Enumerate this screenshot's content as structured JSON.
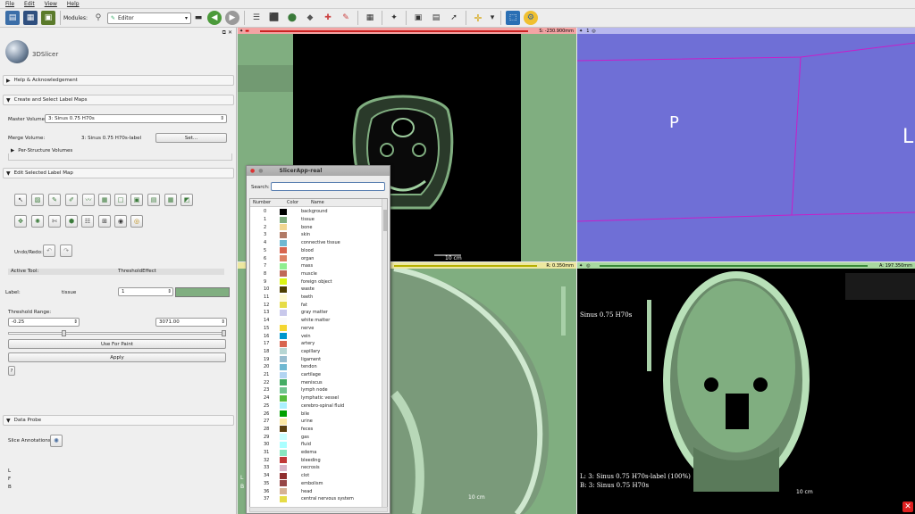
{
  "menu": [
    "File",
    "Edit",
    "View",
    "Help"
  ],
  "toolbar": {
    "modules_label": "Modules:",
    "module_value": "Editor"
  },
  "app_title": "3DSlicer",
  "sections": {
    "help": "Help & Acknowledgement",
    "create": "Create and Select Label Maps",
    "edit": "Edit Selected Label Map",
    "probe": "Data Probe"
  },
  "create": {
    "master_label": "Master Volume:",
    "master_value": "3: Sinus  0.75  H70s",
    "merge_label": "Merge Volume:",
    "merge_value": "3: Sinus  0.75  H70s-label",
    "set_button": "Set...",
    "per_structure": "Per-Structure Volumes"
  },
  "edit": {
    "undo_label": "Undo/Redo:",
    "active_tool_label": "Active Tool:",
    "active_tool_value": "ThresholdEffect",
    "label_label": "Label:",
    "label_name": "tissue",
    "label_value": "1",
    "threshold_label": "Threshold Range:",
    "thr_min": "-0.25",
    "thr_max": "3071.00",
    "use_for_paint": "Use For Paint",
    "apply": "Apply",
    "help_btn": "?"
  },
  "probe": {
    "slice_annotations": "Slice Annotations:",
    "coords": [
      "L",
      "F",
      "B"
    ]
  },
  "views": {
    "red_offset": "S: -230.900mm",
    "yellow_offset": "R: 0.350mm",
    "green_offset": "A: 197.350mm",
    "threeD_num": "1",
    "threeD_p": "P",
    "threeD_l": "L",
    "ruler": "10 cm",
    "green_volume": "Sinus  0.75  H70s",
    "green_label_line": "L: 3: Sinus  0.75  H70s-label (100%)",
    "green_bg_line": "B: 3: Sinus  0.75  H70s",
    "yellow_l": "L",
    "yellow_b": "B"
  },
  "popup": {
    "title": "SlicerApp-real",
    "search_label": "Search:",
    "headers": [
      "Number",
      "Color",
      "Name"
    ],
    "rows": [
      {
        "n": "0",
        "name": "background",
        "color": "#000000"
      },
      {
        "n": "1",
        "name": "tissue",
        "color": "#80ae80"
      },
      {
        "n": "2",
        "name": "bone",
        "color": "#f1d691"
      },
      {
        "n": "3",
        "name": "skin",
        "color": "#b17a65"
      },
      {
        "n": "4",
        "name": "connective tissue",
        "color": "#6fb8d2"
      },
      {
        "n": "5",
        "name": "blood",
        "color": "#d8654f"
      },
      {
        "n": "6",
        "name": "organ",
        "color": "#dd8265"
      },
      {
        "n": "7",
        "name": "mass",
        "color": "#90ee90"
      },
      {
        "n": "8",
        "name": "muscle",
        "color": "#c06858"
      },
      {
        "n": "9",
        "name": "foreign object",
        "color": "#dcf514"
      },
      {
        "n": "10",
        "name": "waste",
        "color": "#4e3f00"
      },
      {
        "n": "11",
        "name": "teeth",
        "color": "#ffface"
      },
      {
        "n": "12",
        "name": "fat",
        "color": "#e6dc46"
      },
      {
        "n": "13",
        "name": "gray matter",
        "color": "#c8c8eb"
      },
      {
        "n": "14",
        "name": "white matter",
        "color": "#fafafa"
      },
      {
        "n": "15",
        "name": "nerve",
        "color": "#f4d631"
      },
      {
        "n": "16",
        "name": "vein",
        "color": "#0097ce"
      },
      {
        "n": "17",
        "name": "artery",
        "color": "#d8654f"
      },
      {
        "n": "18",
        "name": "capillary",
        "color": "#b7d6d3"
      },
      {
        "n": "19",
        "name": "ligament",
        "color": "#98bdcf"
      },
      {
        "n": "20",
        "name": "tendon",
        "color": "#6fb8d2"
      },
      {
        "n": "21",
        "name": "cartilage",
        "color": "#b2d4f2"
      },
      {
        "n": "22",
        "name": "meniscus",
        "color": "#44ac64"
      },
      {
        "n": "23",
        "name": "lymph node",
        "color": "#6fc48e"
      },
      {
        "n": "24",
        "name": "lymphatic vessel",
        "color": "#55bc3d"
      },
      {
        "n": "25",
        "name": "cerebro-spinal fluid",
        "color": "#aaf0ff"
      },
      {
        "n": "26",
        "name": "bile",
        "color": "#00a000"
      },
      {
        "n": "27",
        "name": "urine",
        "color": "#fce8a4"
      },
      {
        "n": "28",
        "name": "feces",
        "color": "#5a3f0e"
      },
      {
        "n": "29",
        "name": "gas",
        "color": "#c8ffff"
      },
      {
        "n": "30",
        "name": "fluid",
        "color": "#a9ffff"
      },
      {
        "n": "31",
        "name": "edema",
        "color": "#88e6c0"
      },
      {
        "n": "32",
        "name": "bleeding",
        "color": "#c03838"
      },
      {
        "n": "33",
        "name": "necrosis",
        "color": "#d8b4c8"
      },
      {
        "n": "34",
        "name": "clot",
        "color": "#8f2e2e"
      },
      {
        "n": "35",
        "name": "embolism",
        "color": "#964646"
      },
      {
        "n": "36",
        "name": "head",
        "color": "#d6b294"
      },
      {
        "n": "37",
        "name": "central nervous system",
        "color": "#e6dc46"
      }
    ]
  }
}
